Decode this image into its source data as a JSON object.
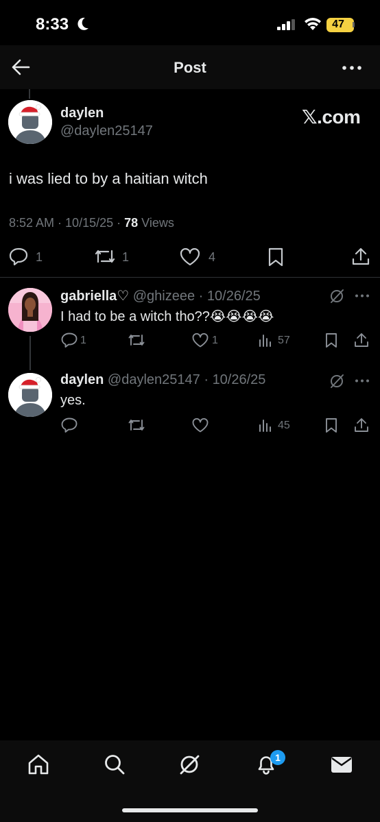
{
  "status_bar": {
    "time": "8:33",
    "battery": "47"
  },
  "header": {
    "title": "Post"
  },
  "post": {
    "author_name": "daylen",
    "author_handle": "@daylen25147",
    "watermark": "𝕏.com",
    "text": "i was lied to by a haitian witch",
    "time": "8:52 AM",
    "date": "10/15/25",
    "views_count": "78",
    "views_label": "Views",
    "replies": "1",
    "reposts": "1",
    "likes": "4"
  },
  "replies": [
    {
      "name": "gabriella♡",
      "handle": "@ghizeee",
      "date": "10/26/25",
      "text": "I had to be a witch tho??😭😭😭😭",
      "replies": "1",
      "likes": "1",
      "views": "57"
    },
    {
      "name": "daylen",
      "handle": "@daylen25147",
      "date": "10/26/25",
      "text": "yes.",
      "views": "45"
    }
  ],
  "tabbar": {
    "notification_count": "1"
  },
  "icons": [
    "moon-icon",
    "signal-icon",
    "wifi-icon",
    "back-arrow-icon",
    "more-icon",
    "reply-icon",
    "repost-icon",
    "like-icon",
    "bookmark-icon",
    "share-icon",
    "views-icon",
    "grok-icon",
    "home-icon",
    "search-icon",
    "bell-icon",
    "mail-icon"
  ],
  "colors": {
    "background": "#000000",
    "text": "#e7e9ea",
    "secondary": "#71767b",
    "accent": "#1d9bf0",
    "battery": "#f5d142"
  }
}
